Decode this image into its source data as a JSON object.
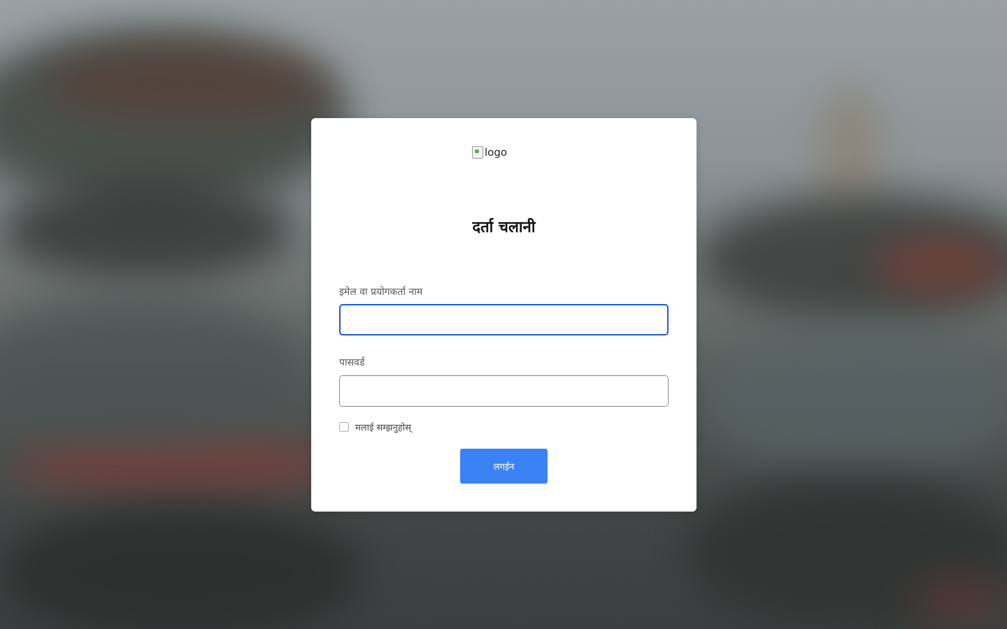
{
  "logo": {
    "alt_text": "logo"
  },
  "title": "दर्ता चलानी",
  "form": {
    "username_label": "इमेल वा प्रयोगकर्ता नाम",
    "username_value": "",
    "password_label": "पासवर्ड",
    "password_value": "",
    "remember_label": "मलाई सम्झनुहोस्",
    "remember_checked": false,
    "submit_label": "लगईन"
  },
  "colors": {
    "primary_button": "#3b82f6",
    "focus_border": "#1a5fd1",
    "card_background": "#ffffff"
  },
  "icons": {
    "logo": "broken-image-icon"
  }
}
